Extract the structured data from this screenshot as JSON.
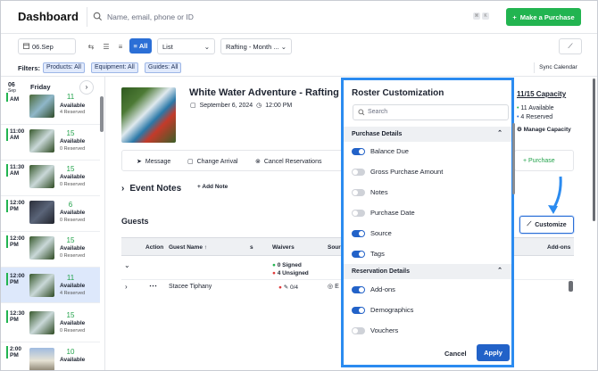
{
  "header": {
    "title": "Dashboard",
    "search_placeholder": "Name, email, phone or ID",
    "make_purchase": "Make a Purchase"
  },
  "toolbar": {
    "date": "06.Sep",
    "all_label": "All",
    "view": "List",
    "activity_filter": "Rafting - Month ..."
  },
  "filters": {
    "label": "Filters:",
    "products": "Products: All",
    "equipment": "Equipment: All",
    "guides": "Guides: All",
    "sync": "Sync Calendar"
  },
  "timeline": {
    "day_num": "06",
    "day_mon": "Sep",
    "day_name": "Friday",
    "slots": [
      {
        "time1": "",
        "time2": "AM",
        "count": "11",
        "avail": "Available",
        "reserved": "4 Reserved"
      },
      {
        "time1": "11:00",
        "time2": "AM",
        "count": "15",
        "avail": "Available",
        "reserved": "0 Reserved"
      },
      {
        "time1": "11:30",
        "time2": "AM",
        "count": "15",
        "avail": "Available",
        "reserved": "0 Reserved"
      },
      {
        "time1": "12:00",
        "time2": "PM",
        "count": "6",
        "avail": "Available",
        "reserved": "0 Reserved"
      },
      {
        "time1": "12:00",
        "time2": "PM",
        "count": "15",
        "avail": "Available",
        "reserved": "0 Reserved"
      },
      {
        "time1": "12:00",
        "time2": "PM",
        "count": "11",
        "avail": "Available",
        "reserved": "4 Reserved"
      },
      {
        "time1": "12:30",
        "time2": "PM",
        "count": "15",
        "avail": "Available",
        "reserved": "0 Reserved"
      },
      {
        "time1": "2:00",
        "time2": "PM",
        "count": "10",
        "avail": "Available",
        "reserved": ""
      }
    ]
  },
  "activity": {
    "title": "White Water Adventure - Rafting To",
    "date": "September 6, 2024",
    "time": "12:00 PM"
  },
  "actions": {
    "message": "Message",
    "change_arrival": "Change Arrival",
    "cancel": "Cancel Reservations"
  },
  "event_notes": {
    "title": "Event Notes",
    "add_note": "Add Note"
  },
  "guests": {
    "title": "Guests",
    "headers": {
      "action": "Action",
      "guest_name": "Guest Name",
      "s": "s",
      "waivers": "Waivers",
      "source": "Sour",
      "addons": "Add-ons"
    },
    "group": {
      "signed": "0 Signed",
      "unsigned": "4 Unsigned"
    },
    "row": {
      "name": "Stacee Tiphany",
      "waiver_count": "0/4",
      "source": "E"
    }
  },
  "capacity": {
    "label": "11/15 Capacity",
    "available": "11 Available",
    "reserved": "4 Reserved",
    "manage": "Manage Capacity",
    "purchase": "Purchase",
    "customize": "Customize"
  },
  "modal": {
    "title": "Roster Customization",
    "search_placeholder": "Search",
    "purchase_details": "Purchase Details",
    "purchase_items": [
      {
        "label": "Balance Due",
        "on": true
      },
      {
        "label": "Gross Purchase Amount",
        "on": false
      },
      {
        "label": "Notes",
        "on": false
      },
      {
        "label": "Purchase Date",
        "on": false
      },
      {
        "label": "Source",
        "on": true
      },
      {
        "label": "Tags",
        "on": true
      }
    ],
    "reservation_details": "Reservation Details",
    "reservation_items": [
      {
        "label": "Add-ons",
        "on": true
      },
      {
        "label": "Demographics",
        "on": true
      },
      {
        "label": "Vouchers",
        "on": false
      }
    ],
    "cancel": "Cancel",
    "apply": "Apply"
  },
  "colors": {
    "accent": "#2262c8",
    "success": "#22b450",
    "highlight_border": "#2b8bf0"
  }
}
